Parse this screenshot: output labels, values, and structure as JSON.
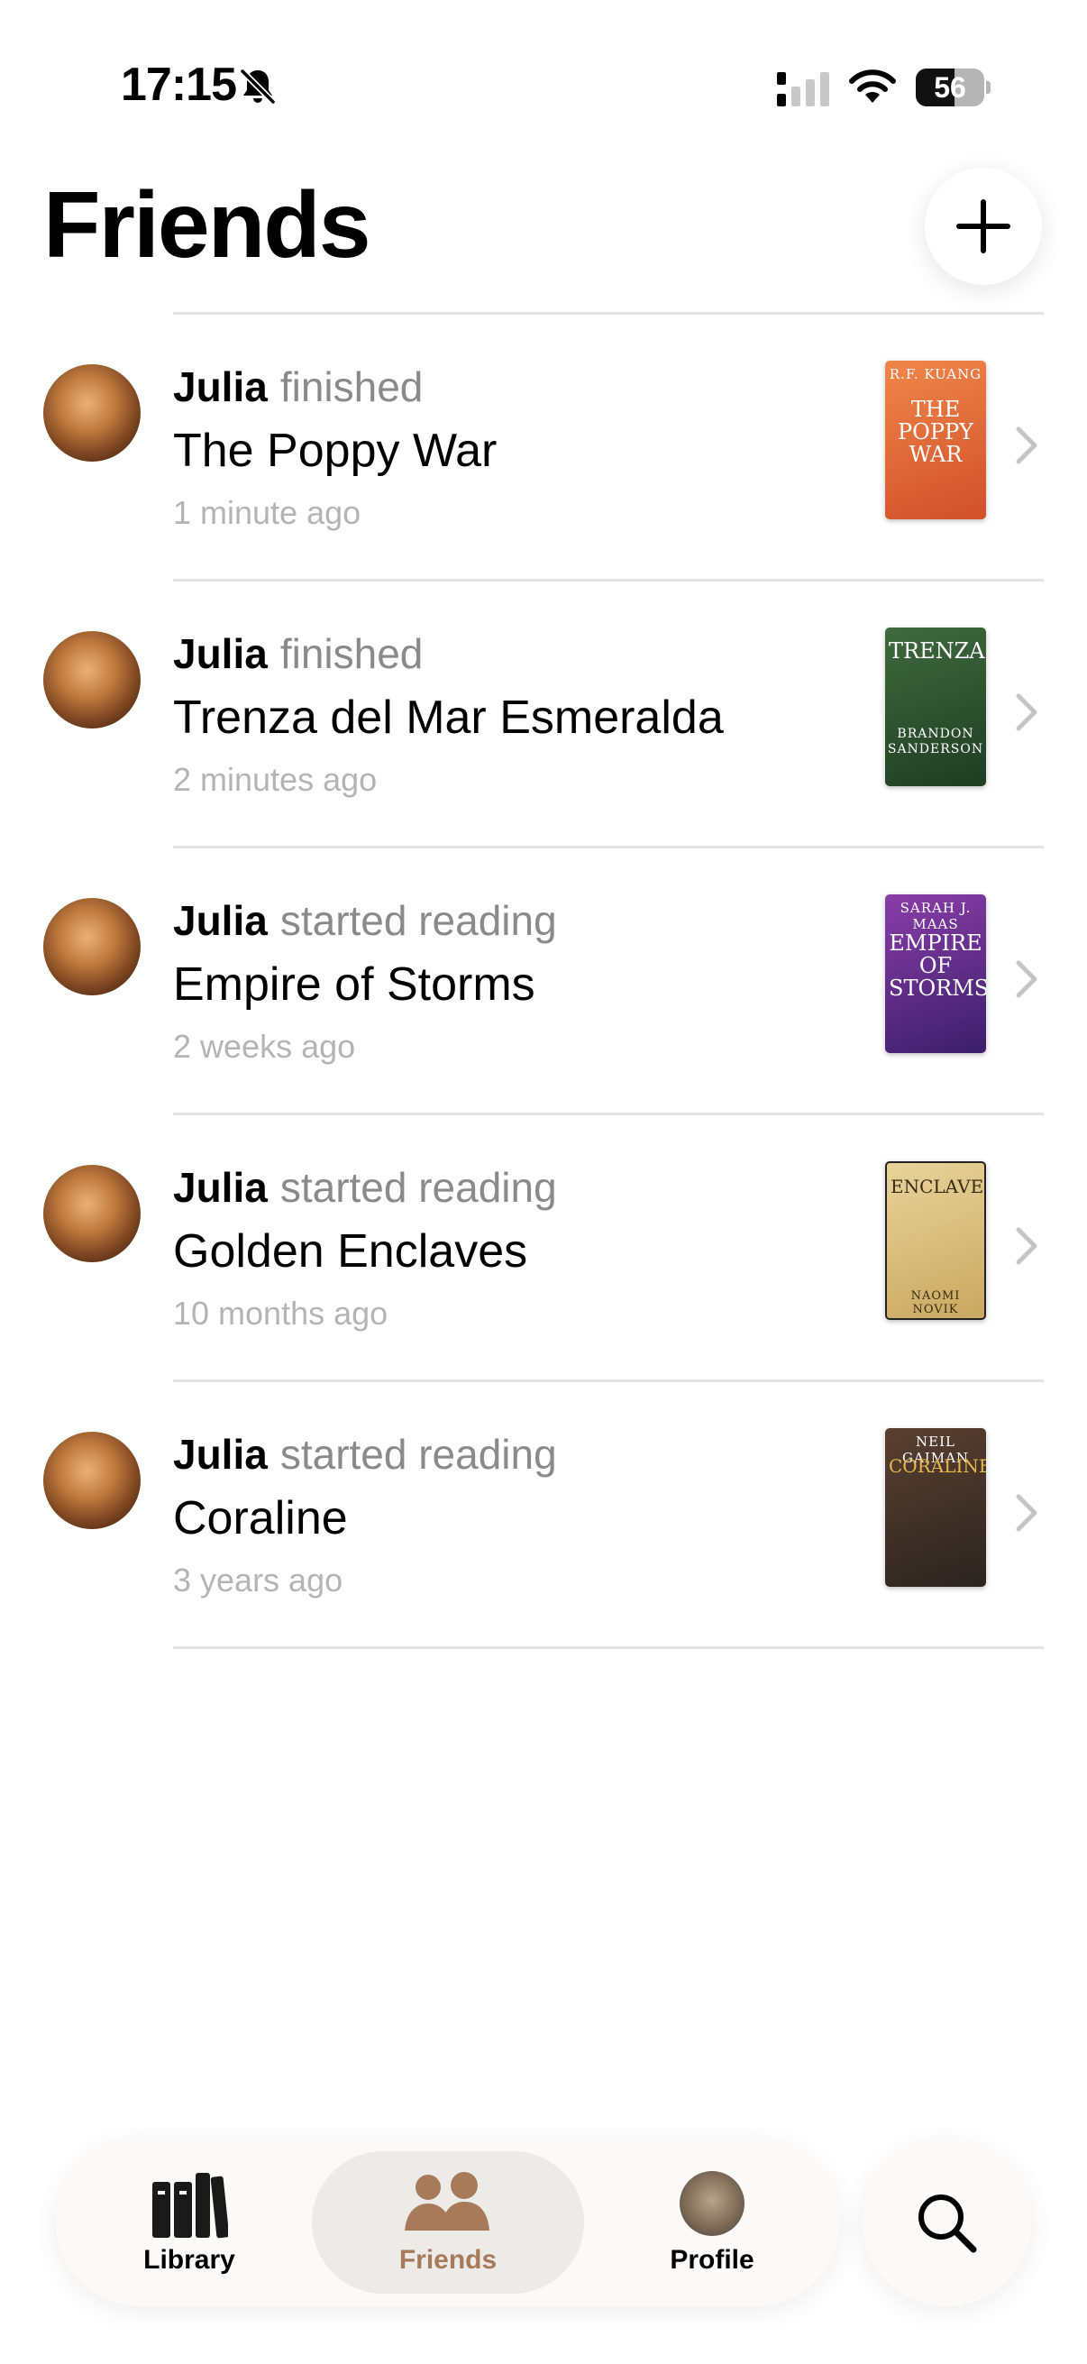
{
  "status_bar": {
    "time": "17:15",
    "battery": "56",
    "battery_level": 0.56,
    "icons": [
      "bell-slash-icon",
      "cellular-signal-icon",
      "wifi-icon",
      "battery-icon"
    ]
  },
  "header": {
    "title": "Friends",
    "add_icon": "plus-icon"
  },
  "feed": {
    "items": [
      {
        "user": "Julia",
        "action": "finished",
        "book": "The Poppy War",
        "time": "1 minute ago",
        "cover": {
          "author": "R.F. KUANG",
          "title": "THE POPPY WAR",
          "colors": [
            "#f0864a",
            "#d0502a"
          ]
        }
      },
      {
        "user": "Julia",
        "action": "finished",
        "book": "Trenza del Mar Esmeralda",
        "time": "2 minutes ago",
        "cover": {
          "author": "BRANDON SANDERSON",
          "title": "TRENZA",
          "colors": [
            "#3e6a3e",
            "#1f3d22"
          ]
        }
      },
      {
        "user": "Julia",
        "action": "started reading",
        "book": "Empire of Storms",
        "time": "2 weeks ago",
        "cover": {
          "author": "SARAH J. MAAS",
          "title": "EMPIRE OF STORMS",
          "colors": [
            "#8a3da8",
            "#3a1f6a"
          ]
        }
      },
      {
        "user": "Julia",
        "action": "started reading",
        "book": "Golden Enclaves",
        "time": "10 months ago",
        "cover": {
          "author": "NAOMI NOVIK",
          "title": "ENCLAVES",
          "colors": [
            "#e8d39a",
            "#c9a860"
          ]
        }
      },
      {
        "user": "Julia",
        "action": "started reading",
        "book": "Coraline",
        "time": "3 years ago",
        "cover": {
          "author": "NEIL GAIMAN",
          "title": "CORALINE",
          "colors": [
            "#5a4030",
            "#2a2420"
          ]
        }
      }
    ]
  },
  "tab_bar": {
    "tabs": [
      {
        "label": "Library",
        "icon": "books-icon",
        "selected": false
      },
      {
        "label": "Friends",
        "icon": "people-icon",
        "selected": true
      },
      {
        "label": "Profile",
        "icon": "profile-avatar",
        "selected": false
      }
    ],
    "search_icon": "search-icon",
    "accent": "#a77a5a"
  }
}
